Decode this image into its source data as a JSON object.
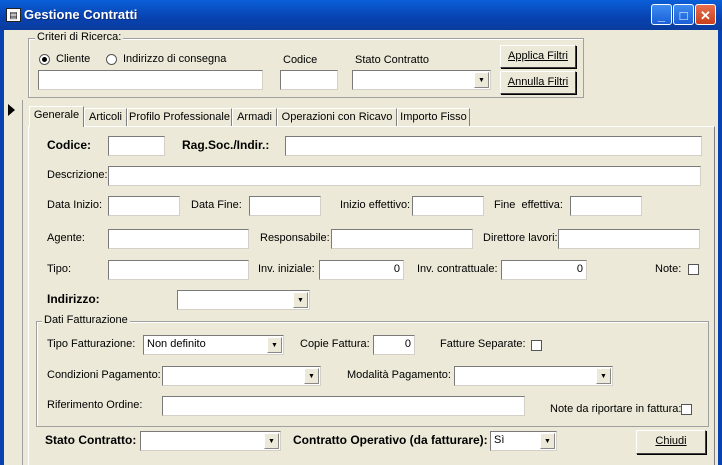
{
  "window": {
    "title": "Gestione Contratti",
    "minimize": "_",
    "maximize": "□",
    "close": "✕",
    "app_icon": "form-icon"
  },
  "criteria": {
    "legend": "Criteri di Ricerca:",
    "radio_cliente": "Cliente",
    "radio_indirizzo": "Indirizzo di consegna",
    "search_value": "",
    "codice_label": "Codice",
    "codice_value": "",
    "stato_label": "Stato Contratto",
    "stato_value": "",
    "apply_label": "Applica Filtri",
    "cancel_label": "Annulla Filtri",
    "selected_radio": "Cliente"
  },
  "tabs": [
    {
      "label": "Generale",
      "active": true
    },
    {
      "label": "Articoli"
    },
    {
      "label": "Profilo Professionale"
    },
    {
      "label": "Armadi"
    },
    {
      "label": "Operazioni con Ricavo"
    },
    {
      "label": "Importo Fisso"
    }
  ],
  "form": {
    "codice_label": "Codice:",
    "codice_value": "",
    "ragsoc_label": "Rag.Soc./Indir.:",
    "ragsoc_value": "",
    "descrizione_label": "Descrizione:",
    "descrizione_value": "",
    "data_inizio_label": "Data Inizio:",
    "data_fine_label": "Data Fine:",
    "inizio_eff_label": "Inizio effettivo:",
    "fine_eff_label": "Fine  effettiva:",
    "agente_label": "Agente:",
    "responsabile_label": "Responsabile:",
    "direttore_label": "Direttore lavori:",
    "tipo_label": "Tipo:",
    "inv_iniziale_label": "Inv. iniziale:",
    "inv_iniziale_value": "0",
    "inv_contr_label": "Inv. contrattuale:",
    "inv_contr_value": "0",
    "note_label": "Note:",
    "indirizzo_label": "Indirizzo:",
    "indirizzo_value": ""
  },
  "fatturazione": {
    "legend": "Dati Fatturazione",
    "tipo_label": "Tipo Fatturazione:",
    "tipo_value": "Non definito",
    "copie_label": "Copie Fattura:",
    "copie_value": "0",
    "separate_label": "Fatture Separate:",
    "condizioni_label": "Condizioni Pagamento:",
    "modalita_label": "Modalità Pagamento:",
    "riferimento_label": "Riferimento Ordine:",
    "note_fattura_label": "Note da riportare in fattura:"
  },
  "footer": {
    "stato_label": "Stato Contratto:",
    "stato_value": "",
    "operativo_label": "Contratto Operativo (da fatturare):",
    "operativo_value": "Sì",
    "chiudi_label": "Chiudi"
  }
}
